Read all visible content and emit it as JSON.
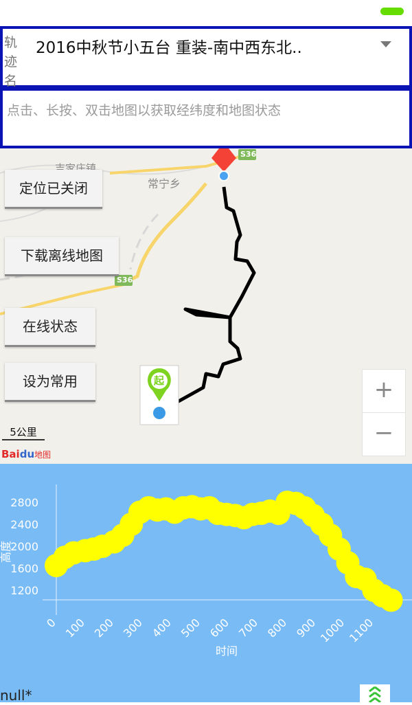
{
  "track": {
    "label": "轨迹名",
    "value": "2016中秋节小五台  重装-南中西东北.."
  },
  "info": {
    "placeholder": "点击、长按、双击地图以获取经纬度和地图状态"
  },
  "map": {
    "buttons": {
      "locate": "定位已关闭",
      "download": "下载离线地图",
      "online": "在线状态",
      "favorite": "设为常用"
    },
    "zoom_in": "+",
    "zoom_out": "−",
    "scale": "5公里",
    "labels": {
      "town_1": "吉家庄镇",
      "town_2": "常宁乡",
      "road_1": "S36",
      "road_2": "S36",
      "start_marker": "起"
    },
    "logo": {
      "text_bai": "Bai",
      "text_du": "du",
      "text_map": "地图"
    },
    "colors": {
      "track": "#000000",
      "road": "#f7d56b",
      "start_pin": "#7ed321",
      "end_pin": "#f44336"
    }
  },
  "chart_data": {
    "type": "scatter",
    "xlabel": "时间",
    "ylabel": "高度",
    "x_ticks": [
      "0",
      "100",
      "200",
      "300",
      "400",
      "500",
      "600",
      "700",
      "800",
      "900",
      "1000",
      "1100"
    ],
    "y_ticks": [
      "1200",
      "1600",
      "2000",
      "2400",
      "2800"
    ],
    "xlim": [
      0,
      1180
    ],
    "ylim": [
      1000,
      3000
    ],
    "marker_color": "#ffff00",
    "series": [
      {
        "x": [
          0,
          30,
          60,
          100,
          130,
          160,
          200,
          230,
          260,
          290,
          320,
          350,
          380,
          410,
          440,
          470,
          500,
          530,
          560,
          590,
          620,
          650,
          680,
          710,
          740,
          770,
          800,
          830,
          860,
          890,
          920,
          950,
          980,
          1010,
          1040,
          1070,
          1100,
          1130,
          1160
        ],
        "y": [
          1650,
          1800,
          1880,
          1920,
          1950,
          2000,
          2080,
          2200,
          2400,
          2620,
          2700,
          2660,
          2680,
          2620,
          2700,
          2720,
          2680,
          2700,
          2600,
          2580,
          2560,
          2520,
          2580,
          2600,
          2640,
          2600,
          2800,
          2780,
          2700,
          2560,
          2400,
          2200,
          1950,
          1700,
          1450,
          1400,
          1200,
          1100,
          1020
        ]
      }
    ]
  },
  "footer": {
    "null_text": "null*"
  }
}
